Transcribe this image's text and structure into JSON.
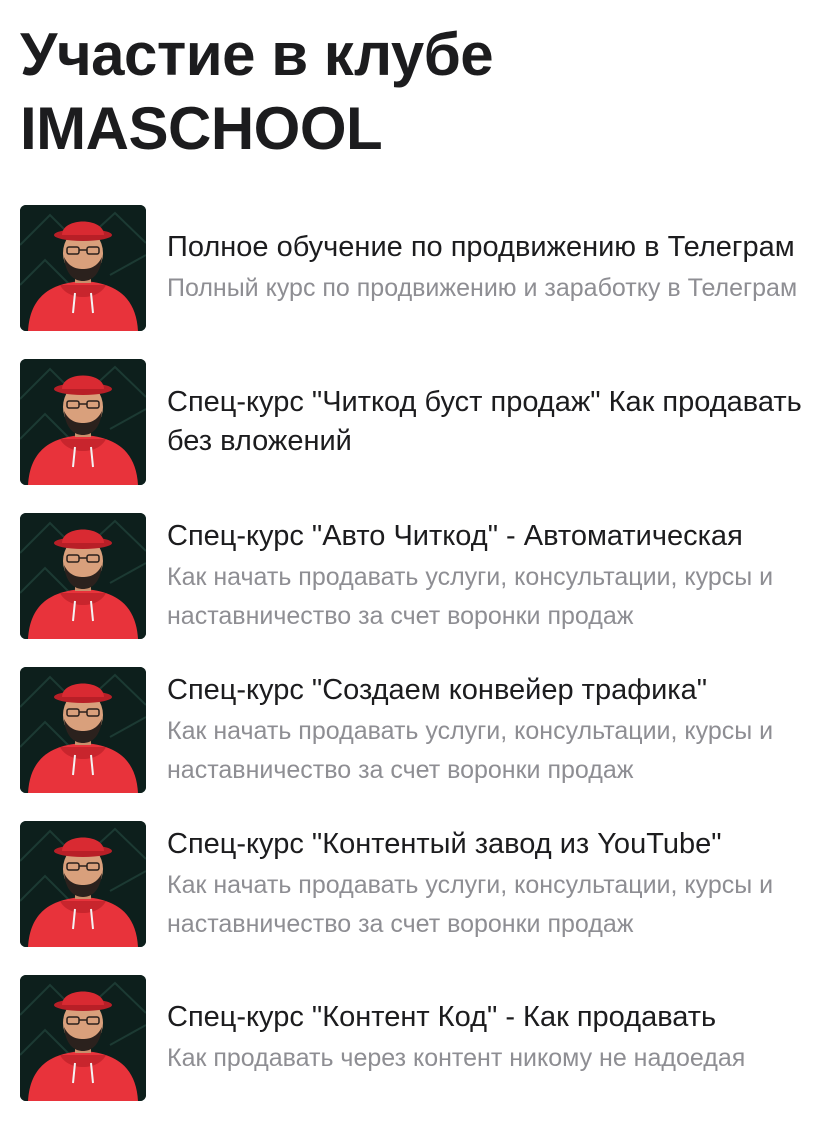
{
  "header": {
    "title": "Участие в клубе\nIMASCHOOL"
  },
  "thumbnail": {
    "icon": "author-photo-red-hoodie-icon",
    "colors": {
      "background": "#0d1f1c",
      "hoodie": "#e8333b",
      "cap": "#d92a32",
      "skin": "#d9a07c",
      "beard": "#2b211d"
    }
  },
  "courses": [
    {
      "title": "Полное обучение по продвижению в Телеграм",
      "subtitle": "Полный курс по продвижению и заработку в Телеграм"
    },
    {
      "title": "Спец-курс \"Читкод буст продаж\" Как продавать без вложений",
      "subtitle": ""
    },
    {
      "title": "Спец-курс \"Авто Читкод\" - Автоматическая",
      "subtitle": "Как начать продавать услуги, консультации, курсы и наставничество за счет воронки продаж"
    },
    {
      "title": "Спец-курс \"Создаем конвейер трафика\"",
      "subtitle": "Как начать продавать услуги, консультации, курсы и наставничество за счет воронки продаж"
    },
    {
      "title": "Спец-курс \"Контентый завод из YouTube\"",
      "subtitle": "Как начать продавать услуги, консультации, курсы и наставничество за счет воронки продаж"
    },
    {
      "title": "Спец-курс \"Контент Код\" - Как продавать",
      "subtitle": "Как продавать через контент никому не надоедая"
    }
  ]
}
